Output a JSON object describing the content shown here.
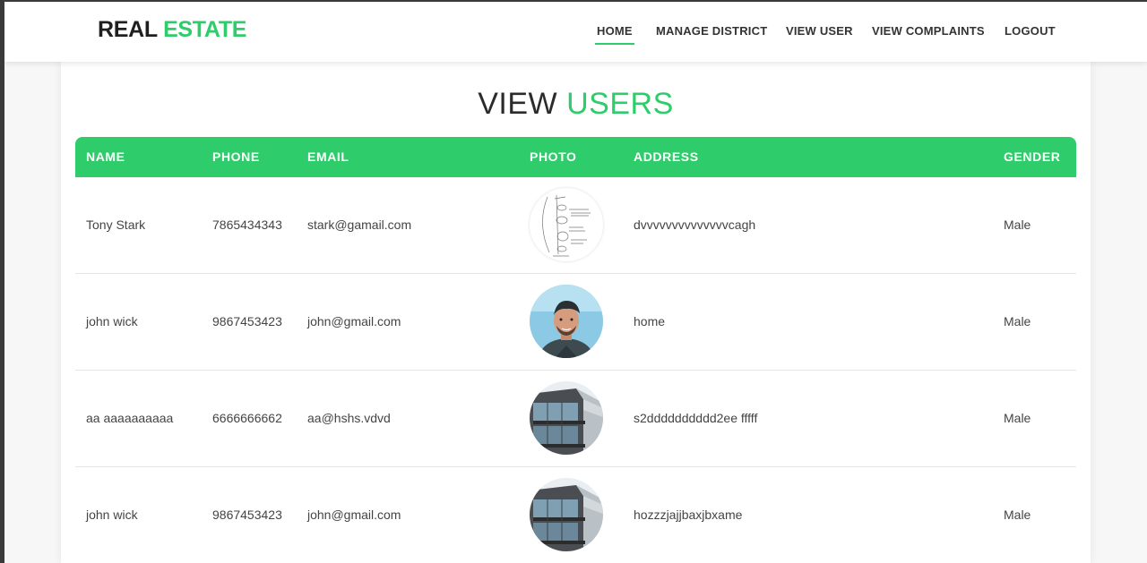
{
  "navbar": {
    "brand_part1": "REAL",
    "brand_part2": "ESTATE",
    "links": [
      {
        "label": "HOME",
        "active": true
      },
      {
        "label": "MANAGE DISTRICT"
      },
      {
        "label": "VIEW USER"
      },
      {
        "label": "VIEW COMPLAINTS"
      },
      {
        "label": "LOGOUT"
      }
    ]
  },
  "page": {
    "title_part1": "VIEW",
    "title_part2": "USERS"
  },
  "table": {
    "headers": [
      "NAME",
      "PHONE",
      "EMAIL",
      "PHOTO",
      "ADDRESS",
      "GENDER"
    ],
    "rows": [
      {
        "name": "Tony Stark",
        "phone": "7865434343",
        "email": "stark@gamail.com",
        "photo": "sketch-document-photo",
        "address": "dvvvvvvvvvvvvvvcagh",
        "gender": "Male"
      },
      {
        "name": "john wick",
        "phone": "9867453423",
        "email": "john@gmail.com",
        "photo": "portrait-photo",
        "address": "home",
        "gender": "Male"
      },
      {
        "name": "aa aaaaaaaaaa",
        "phone": "6666666662",
        "email": "aa@hshs.vdvd",
        "photo": "building-photo",
        "address": "s2dddddddddd2ee fffff",
        "gender": "Male"
      },
      {
        "name": "john wick",
        "phone": "9867453423",
        "email": "john@gmail.com",
        "photo": "building-photo",
        "address": "hozzzjajjbaxjbxame",
        "gender": "Male"
      }
    ]
  },
  "colors": {
    "accent": "#2ecc6a",
    "text": "#444444"
  }
}
